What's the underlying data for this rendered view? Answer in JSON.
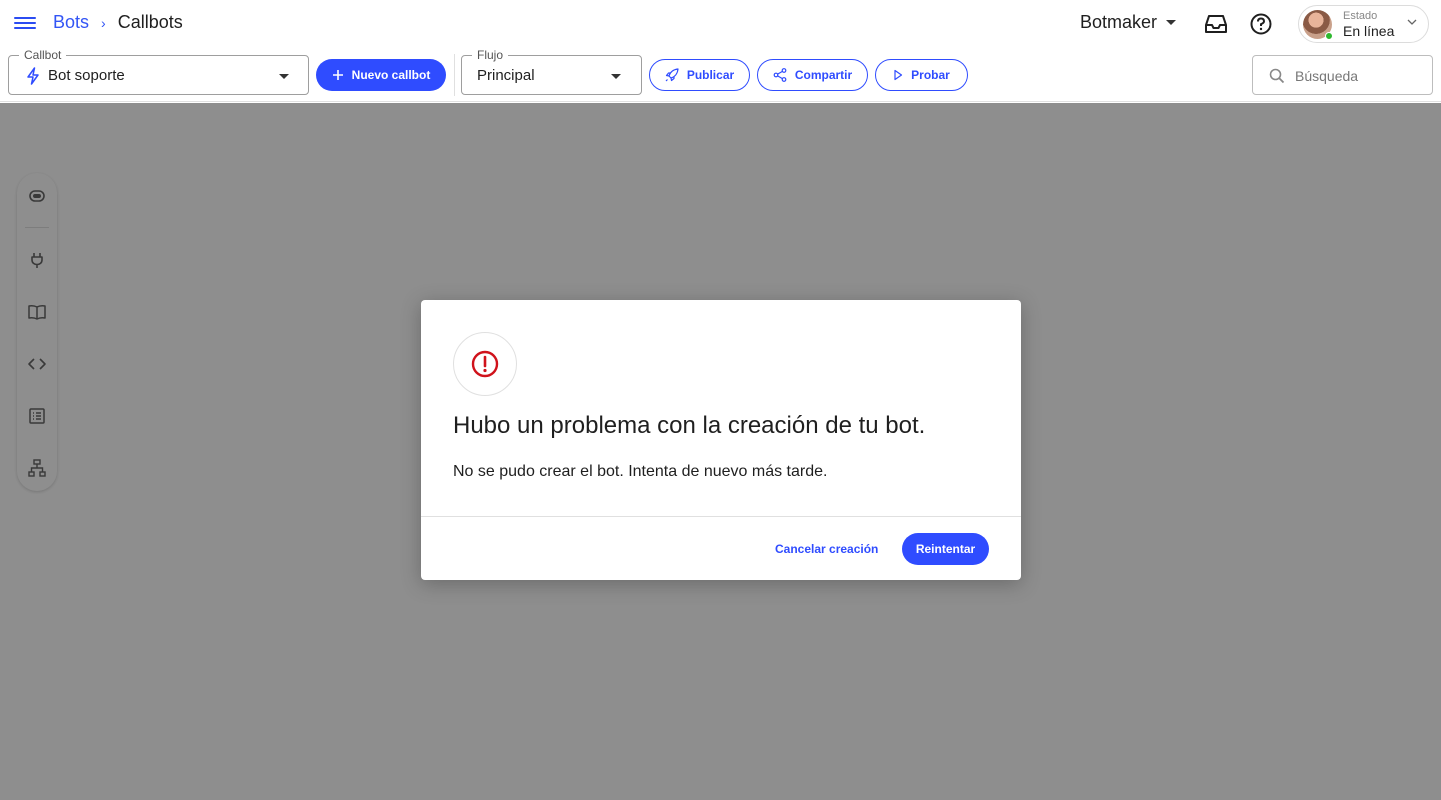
{
  "header": {
    "breadcrumb": {
      "parent": "Bots",
      "separator": "›",
      "current": "Callbots"
    },
    "org_name": "Botmaker",
    "status": {
      "label": "Estado",
      "value": "En línea",
      "indicator_color": "#2eb82e"
    }
  },
  "toolbar": {
    "callbot_field": {
      "label": "Callbot",
      "value": "Bot soporte"
    },
    "new_callbot_label": "Nuevo callbot",
    "flow_field": {
      "label": "Flujo",
      "value": "Principal"
    },
    "publish_label": "Publicar",
    "share_label": "Compartir",
    "test_label": "Probar",
    "search": {
      "placeholder": "Búsqueda"
    }
  },
  "side_rail": {
    "icons": [
      "bot-icon",
      "plug-icon",
      "book-icon",
      "code-icon",
      "list-icon",
      "flow-tree-icon"
    ]
  },
  "modal": {
    "title": "Hubo un problema con la creación de tu bot.",
    "body": "No se pudo crear el bot. Intenta de nuevo más tarde.",
    "cancel_label": "Cancelar creación",
    "retry_label": "Reintentar",
    "icon": "error-icon",
    "icon_color": "#d0121b"
  },
  "colors": {
    "accent": "#2f4cff",
    "overlay": "rgba(30,30,30,0.5)"
  }
}
